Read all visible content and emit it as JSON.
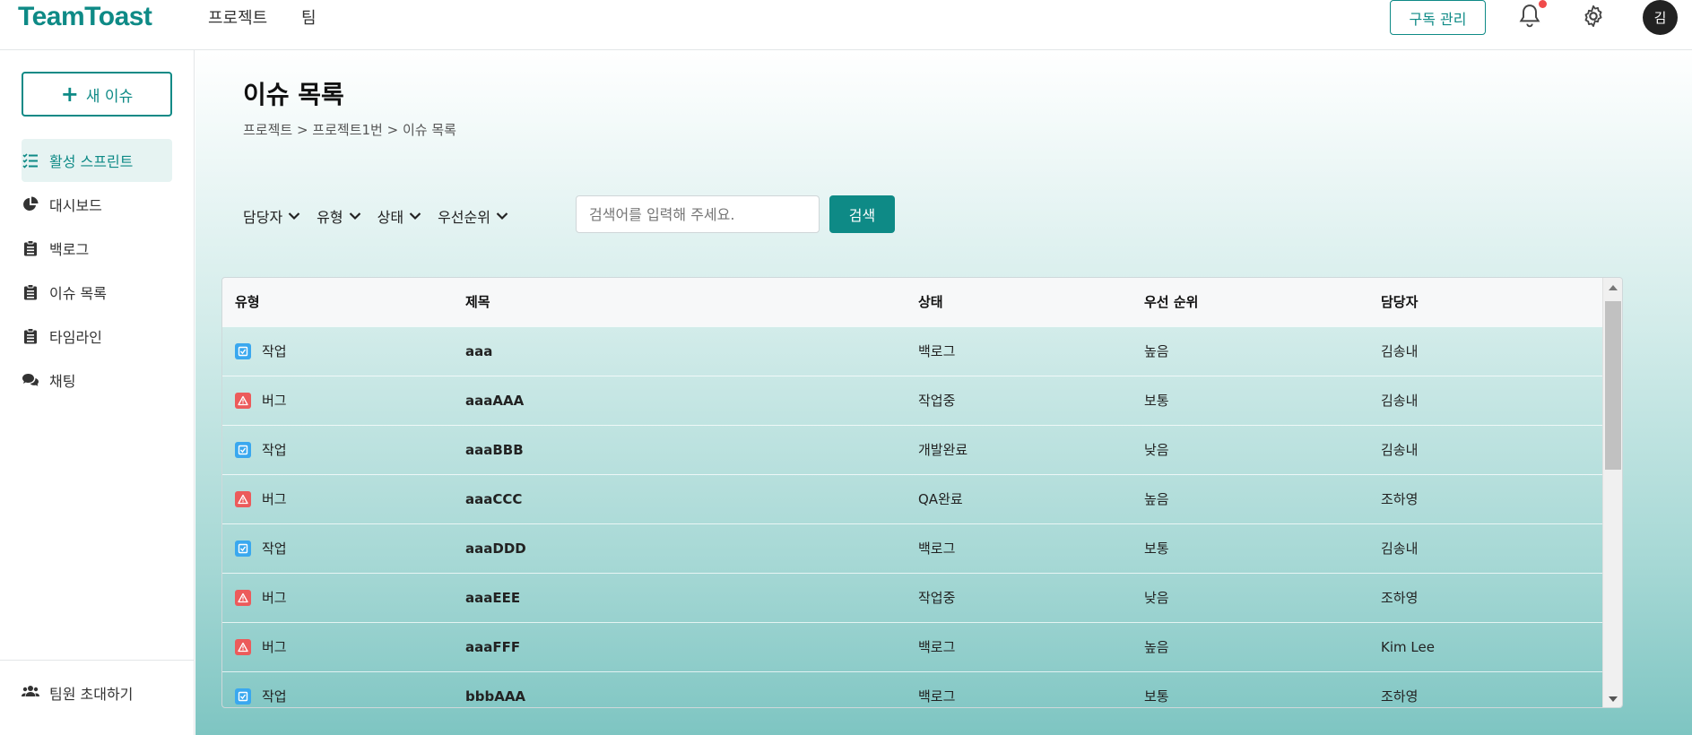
{
  "app": {
    "logo": "TeamToast"
  },
  "topnav": {
    "items": [
      "프로젝트",
      "팀"
    ]
  },
  "header": {
    "subscribe_label": "구독 관리",
    "avatar_initial": "김"
  },
  "sidebar": {
    "new_issue_label": "새 이슈",
    "items": [
      {
        "label": "활성 스프린트",
        "icon": "list-check-icon",
        "active": true
      },
      {
        "label": "대시보드",
        "icon": "pie-chart-icon"
      },
      {
        "label": "백로그",
        "icon": "clipboard-icon"
      },
      {
        "label": "이슈 목록",
        "icon": "clipboard-icon"
      },
      {
        "label": "타임라인",
        "icon": "clipboard-icon"
      },
      {
        "label": "채팅",
        "icon": "chat-icon"
      }
    ],
    "invite_label": "팀원 초대하기"
  },
  "main": {
    "title": "이슈 목록",
    "breadcrumb": "프로젝트 > 프로젝트1번 > 이슈 목록",
    "filters": [
      "담당자",
      "유형",
      "상태",
      "우선순위"
    ],
    "search_placeholder": "검색어를 입력해 주세요.",
    "search_label": "검색"
  },
  "table": {
    "headers": [
      "유형",
      "제목",
      "상태",
      "우선 순위",
      "담당자"
    ],
    "rows": [
      {
        "type": "작업",
        "kind": "task",
        "title": "aaa",
        "status": "백로그",
        "priority": "높음",
        "assignee": "김송내"
      },
      {
        "type": "버그",
        "kind": "bug",
        "title": "aaaAAA",
        "status": "작업중",
        "priority": "보통",
        "assignee": "김송내"
      },
      {
        "type": "작업",
        "kind": "task",
        "title": "aaaBBB",
        "status": "개발완료",
        "priority": "낮음",
        "assignee": "김송내"
      },
      {
        "type": "버그",
        "kind": "bug",
        "title": "aaaCCC",
        "status": "QA완료",
        "priority": "높음",
        "assignee": "조하영"
      },
      {
        "type": "작업",
        "kind": "task",
        "title": "aaaDDD",
        "status": "백로그",
        "priority": "보통",
        "assignee": "김송내"
      },
      {
        "type": "버그",
        "kind": "bug",
        "title": "aaaEEE",
        "status": "작업중",
        "priority": "낮음",
        "assignee": "조하영"
      },
      {
        "type": "버그",
        "kind": "bug",
        "title": "aaaFFF",
        "status": "백로그",
        "priority": "높음",
        "assignee": "Kim Lee"
      },
      {
        "type": "작업",
        "kind": "task",
        "title": "bbbAAA",
        "status": "백로그",
        "priority": "보통",
        "assignee": "조하영"
      }
    ]
  },
  "colors": {
    "brand": "#0e8a86",
    "task": "#3aa8ef",
    "bug": "#ec5b5b",
    "notification": "#f04b4b"
  }
}
